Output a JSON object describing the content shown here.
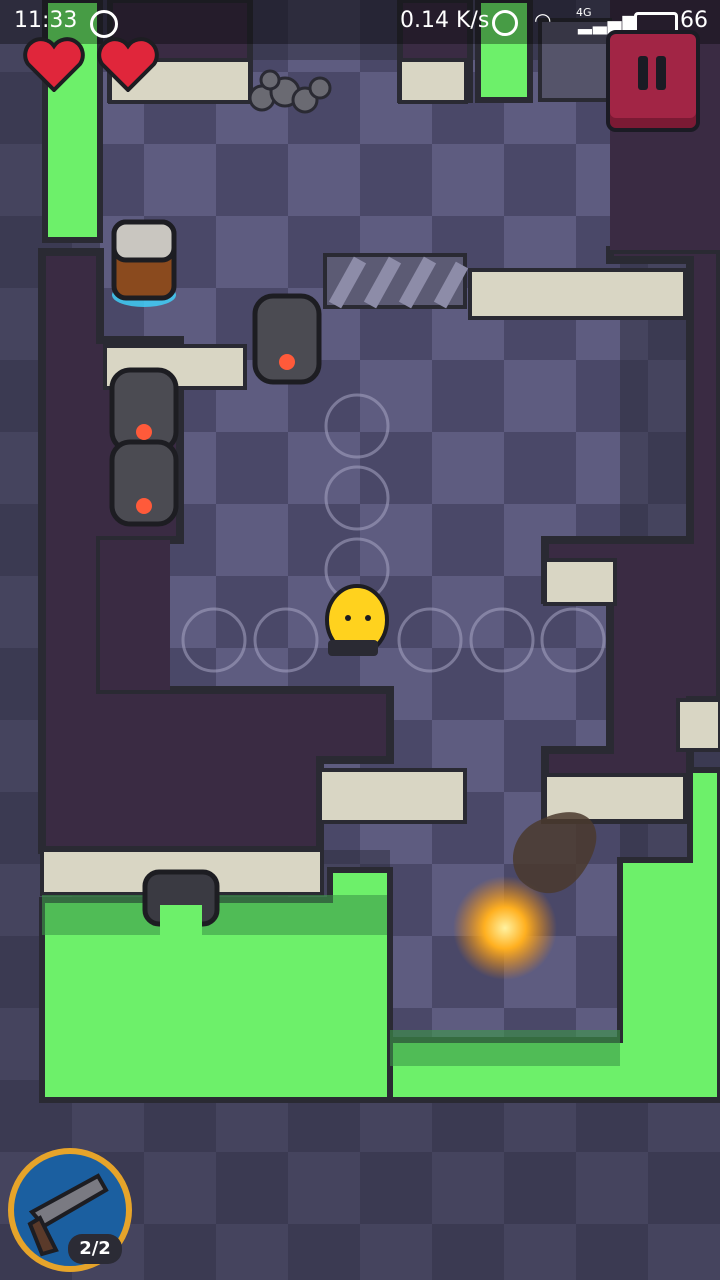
{
  "status_bar": {
    "time": "11:33",
    "network_speed": "0.14 K/s",
    "signal": "4G",
    "battery": "66"
  },
  "hud": {
    "lives": 2,
    "pause_icon": "pause-icon",
    "weapon": {
      "name": "revolver",
      "ammo": "2/2"
    }
  },
  "colors": {
    "floor_dark": "#4a4868",
    "floor_light": "#5e5c80",
    "wall_fill": "#3a2b43",
    "wall_edge": "#d9d6c4",
    "toxic": "#6df06a",
    "pause_bg": "#a22545",
    "heart": "#e0263b",
    "player": "#ffd21e",
    "explosion": "#ffb020",
    "weapon_bg": "#1b5fa0",
    "weapon_ring": "#e6a42a"
  }
}
